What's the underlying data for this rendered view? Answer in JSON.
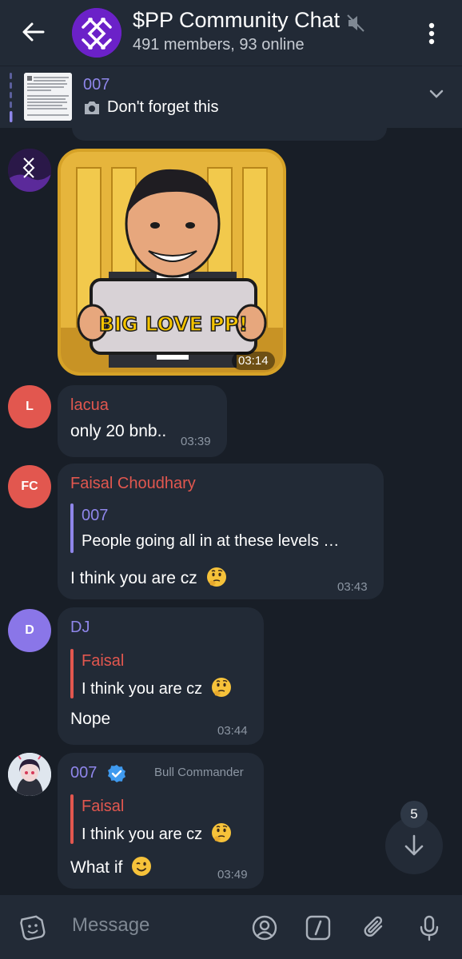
{
  "header": {
    "title": "$PP Community Chat",
    "subtitle": "491 members, 93 online",
    "back_icon": "arrow-left-icon",
    "mute_icon": "muted-speaker-icon",
    "menu_icon": "more-vertical-icon"
  },
  "pinned": {
    "sender": "007",
    "text": "Don't forget this",
    "icon": "camera-icon",
    "expand_icon": "chevron-down-icon"
  },
  "messages": [
    {
      "type": "sticker",
      "caption": "BIG LOVE PP!",
      "time": "03:14"
    },
    {
      "sender": "lacua",
      "avatar_initial": "L",
      "avatar_color": "#e2574f",
      "name_color": "#e2574f",
      "text": "only 20 bnb..",
      "time": "03:39"
    },
    {
      "sender": "Faisal Choudhary",
      "avatar_initial": "FC",
      "avatar_color": "#e2574f",
      "name_color": "#e2574f",
      "reply": {
        "name": "007",
        "text": "People going all in at these levels …"
      },
      "text": "I think you are cz",
      "time": "03:43"
    },
    {
      "sender": "DJ",
      "avatar_initial": "D",
      "avatar_color": "#8a76e8",
      "name_color": "#8f86ea",
      "reply": {
        "name": "Faisal",
        "text": "I think you are cz"
      },
      "text": "Nope",
      "time": "03:44"
    },
    {
      "sender": "007",
      "badge": "Bull Commander",
      "name_color": "#8f86ea",
      "reply": {
        "name": "Faisal",
        "text": "I think you are cz"
      },
      "text": "What if",
      "time": "03:49"
    }
  ],
  "scroll": {
    "count": "5"
  },
  "composer": {
    "placeholder": "Message"
  },
  "colors": {
    "background": "#181e27",
    "surface": "#222a36",
    "accent": "#8f86ea",
    "red": "#e2574f",
    "verified": "#3f9aef"
  }
}
